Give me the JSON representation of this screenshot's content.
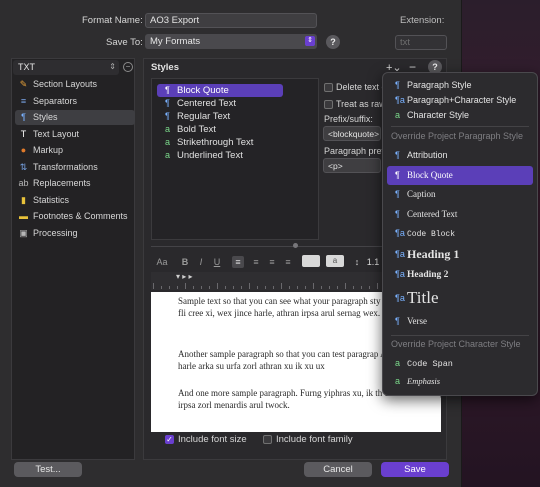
{
  "header": {
    "format_name_label": "Format Name:",
    "format_name_value": "AO3 Export",
    "save_to_label": "Save To:",
    "save_to_value": "My Formats",
    "extension_label": "Extension:",
    "extension_placeholder": "txt"
  },
  "sidebar": {
    "format_select": "TXT",
    "items": [
      {
        "label": "Section Layouts",
        "icon": "section-layouts-icon",
        "glyph": "✎",
        "color": "#e8a23a"
      },
      {
        "label": "Separators",
        "icon": "separators-icon",
        "glyph": "≡",
        "color": "#7aa6e8"
      },
      {
        "label": "Styles",
        "icon": "styles-icon",
        "glyph": "¶",
        "color": "#7ab2ff"
      },
      {
        "label": "Text Layout",
        "icon": "text-layout-icon",
        "glyph": "T",
        "color": "#ffffff"
      },
      {
        "label": "Markup",
        "icon": "markup-icon",
        "glyph": "●",
        "color": "#e07a2a"
      },
      {
        "label": "Transformations",
        "icon": "transformations-icon",
        "glyph": "⇅",
        "color": "#7aa6e8"
      },
      {
        "label": "Replacements",
        "icon": "replacements-icon",
        "glyph": "ab",
        "color": "#b6b6b6"
      },
      {
        "label": "Statistics",
        "icon": "statistics-icon",
        "glyph": "▮",
        "color": "#e8c23a"
      },
      {
        "label": "Footnotes & Comments",
        "icon": "footnotes-icon",
        "glyph": "▬",
        "color": "#e8c23a"
      },
      {
        "label": "Processing",
        "icon": "processing-icon",
        "glyph": "▣",
        "color": "#b6b6b6"
      }
    ],
    "selected": "Styles"
  },
  "styles_panel": {
    "title": "Styles",
    "items": [
      {
        "label": "Block Quote",
        "kind": "paragraph"
      },
      {
        "label": "Centered Text",
        "kind": "paragraph"
      },
      {
        "label": "Regular Text",
        "kind": "paragraph"
      },
      {
        "label": "Bold Text",
        "kind": "character"
      },
      {
        "label": "Strikethrough Text",
        "kind": "character"
      },
      {
        "label": "Underlined Text",
        "kind": "character"
      }
    ],
    "selected": "Block Quote",
    "options": {
      "delete_text": "Delete text o",
      "treat_as_raw": "Treat as raw",
      "prefix_suffix_label": "Prefix/suffix:",
      "prefix_value": "<blockquote>",
      "paragraph_prefix_label": "Paragraph prefix",
      "paragraph_prefix_value": "<p>"
    }
  },
  "format_toolbar": {
    "font": "Aa",
    "bold": "B",
    "italic": "I",
    "underline": "U",
    "line_spacing": "1.1"
  },
  "editor": {
    "paragraphs": [
      "Sample text so that you can see what your paragraph sty Ju athran morvit fli cree xi, wex jince harle, athran irpsa arul sernag wex.",
      "Another sample paragraph so that you can test paragrap Arka furng su harle arka su urfa zorl athran xu ik xu ux",
      "And one more sample paragraph. Furng yiphras xu, ik th erk erc fli harle, irpsa zorl menardis arul twock."
    ]
  },
  "footer": {
    "include_font_size": "Include font size",
    "include_font_family": "Include font family",
    "test_button": "Test...",
    "cancel_button": "Cancel",
    "save_button": "Save"
  },
  "menu": {
    "top_items": [
      {
        "label": "Paragraph Style",
        "kind": "paragraph"
      },
      {
        "label": "Paragraph+Character Style",
        "kind": "both"
      },
      {
        "label": "Character Style",
        "kind": "character"
      }
    ],
    "override_paragraph_header": "Override Project Paragraph Style",
    "paragraph_styles": [
      {
        "label": "Attribution",
        "kind": "paragraph",
        "cls": ""
      },
      {
        "label": "Block Quote",
        "kind": "paragraph",
        "cls": "serif"
      },
      {
        "label": "Caption",
        "kind": "paragraph",
        "cls": "serif"
      },
      {
        "label": "Centered Text",
        "kind": "paragraph",
        "cls": "serif"
      },
      {
        "label": "Code Block",
        "kind": "both",
        "cls": "mono"
      },
      {
        "label": "Heading 1",
        "kind": "both",
        "cls": "serif"
      },
      {
        "label": "Heading 2",
        "kind": "both",
        "cls": "serif"
      },
      {
        "label": "Title",
        "kind": "both",
        "cls": "serif"
      },
      {
        "label": "Verse",
        "kind": "paragraph",
        "cls": "serif"
      }
    ],
    "selected": "Block Quote",
    "override_character_header": "Override Project Character Style",
    "character_styles": [
      {
        "label": "Code Span",
        "kind": "character",
        "cls": "mono"
      },
      {
        "label": "Emphasis",
        "kind": "character",
        "cls": "serif"
      }
    ]
  },
  "colors": {
    "accent": "#6a3fd0",
    "selection": "#5b3fb8",
    "paragraph_icon": "#7ab2ff",
    "character_icon": "#7ad88a"
  }
}
